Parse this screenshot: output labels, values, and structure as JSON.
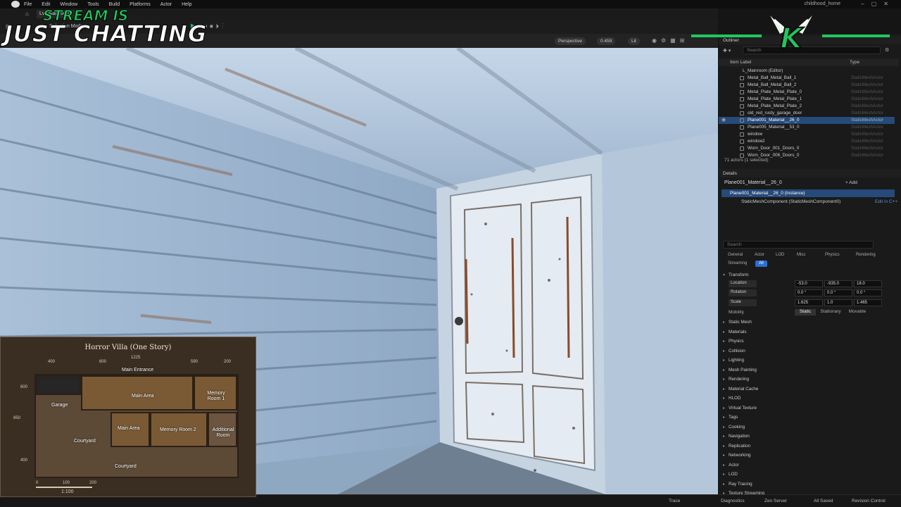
{
  "menu": {
    "items": [
      "File",
      "Edit",
      "Window",
      "Tools",
      "Build",
      "Platforms",
      "Actor",
      "Help"
    ],
    "project": "childhood_home"
  },
  "tab": {
    "label": "Lvl_Mainroom"
  },
  "toolbar": {
    "selection_mode": "Selection Mode"
  },
  "viewport": {
    "perspective": "Perspective",
    "fov": "0.459",
    "lit": "Lit"
  },
  "overlay": {
    "line1": "STREAM IS",
    "line2": "JUST CHATTING"
  },
  "minimap": {
    "title": "Horror Villa (One Story)",
    "dims": {
      "top_1225": "1225",
      "top_400": "400",
      "top_600": "600",
      "top_590": "590",
      "top_200": "200",
      "left_600": "600",
      "left_850": "850",
      "left_400": "400",
      "scale_0": "0",
      "scale_100": "100",
      "scale_200": "200"
    },
    "scale": "1:100",
    "rooms": {
      "main_entrance": "Main Entrance",
      "garage": "Garage",
      "main_area_top": "Main Area",
      "memory_room_1": "Memory Room 1",
      "main_area": "Main Area",
      "memory_room_2": "Memory Room 2",
      "additional_room": "Additional Room",
      "courtyard_left": "Courtyard",
      "courtyard_bottom": "Courtyard"
    }
  },
  "outliner": {
    "title": "Outliner",
    "search_placeholder": "Search",
    "col_label": "Item Label",
    "col_type": "Type",
    "root": "L_Mainroom (Editor)",
    "rows": [
      {
        "name": "Metal_Ball_Metal_Ball_1",
        "type": "StaticMeshActor"
      },
      {
        "name": "Metal_Ball_Metal_Ball_2",
        "type": "StaticMeshActor"
      },
      {
        "name": "Metal_Plate_Metal_Plate_0",
        "type": "StaticMeshActor"
      },
      {
        "name": "Metal_Plate_Metal_Plate_1",
        "type": "StaticMeshActor"
      },
      {
        "name": "Metal_Plate_Metal_Plate_2",
        "type": "StaticMeshActor"
      },
      {
        "name": "old_red_rusty_garage_door",
        "type": "StaticMeshActor"
      },
      {
        "name": "Plane001_Material__26_0",
        "type": "StaticMeshActor"
      },
      {
        "name": "Plane005_Material__53_0",
        "type": "StaticMeshActor"
      },
      {
        "name": "window",
        "type": "StaticMeshActor"
      },
      {
        "name": "window2",
        "type": "StaticMeshActor"
      },
      {
        "name": "Worn_Door_001_Doors_0",
        "type": "StaticMeshActor"
      },
      {
        "name": "Worn_Door_006_Doors_0",
        "type": "StaticMeshActor"
      }
    ],
    "count": "71 actors (1 selected)"
  },
  "details": {
    "title": "Details",
    "actor_name": "Plane001_Material__26_0",
    "add_label": "+ Add",
    "instance": "Plane001_Material__26_0 (Instance)",
    "component": "StaticMeshComponent (StaticMeshComponent0)",
    "edit_cpp": "Edit in C++",
    "search_placeholder": "Search",
    "categories": [
      "General",
      "Actor",
      "LOD",
      "Misc",
      "Physics",
      "Rendering",
      "Streaming",
      "All"
    ],
    "transform_label": "Transform",
    "location_label": "Location",
    "rotation_label": "Rotation",
    "scale_label": "Scale",
    "location": [
      "-53.0",
      "-935.0",
      "18.0"
    ],
    "rotation": [
      "0.0 °",
      "0.0 °",
      "0.0 °"
    ],
    "scale": [
      "1.625",
      "1.0",
      "1.465"
    ],
    "mobility_label": "Mobility",
    "mobility": [
      "Static",
      "Stationary",
      "Movable"
    ],
    "sections": [
      "Static Mesh",
      "Materials",
      "Physics",
      "Collision",
      "Lighting",
      "Mesh Painting",
      "Rendering",
      "Material Cache",
      "HLOD",
      "Virtual Texture",
      "Tags",
      "Cooking",
      "Navigation",
      "Replication",
      "Networking",
      "Actor",
      "LOD",
      "Ray Tracing",
      "Texture Streaming"
    ]
  },
  "status": {
    "trace": "Trace",
    "diagnostics": "Diagnostics",
    "zen": "Zen Server",
    "saved": "All Saved",
    "revision": "Revision Control"
  },
  "colors": {
    "accent": "#22c55e",
    "selection": "#264a7a",
    "all_tab": "#2a6fd6"
  }
}
